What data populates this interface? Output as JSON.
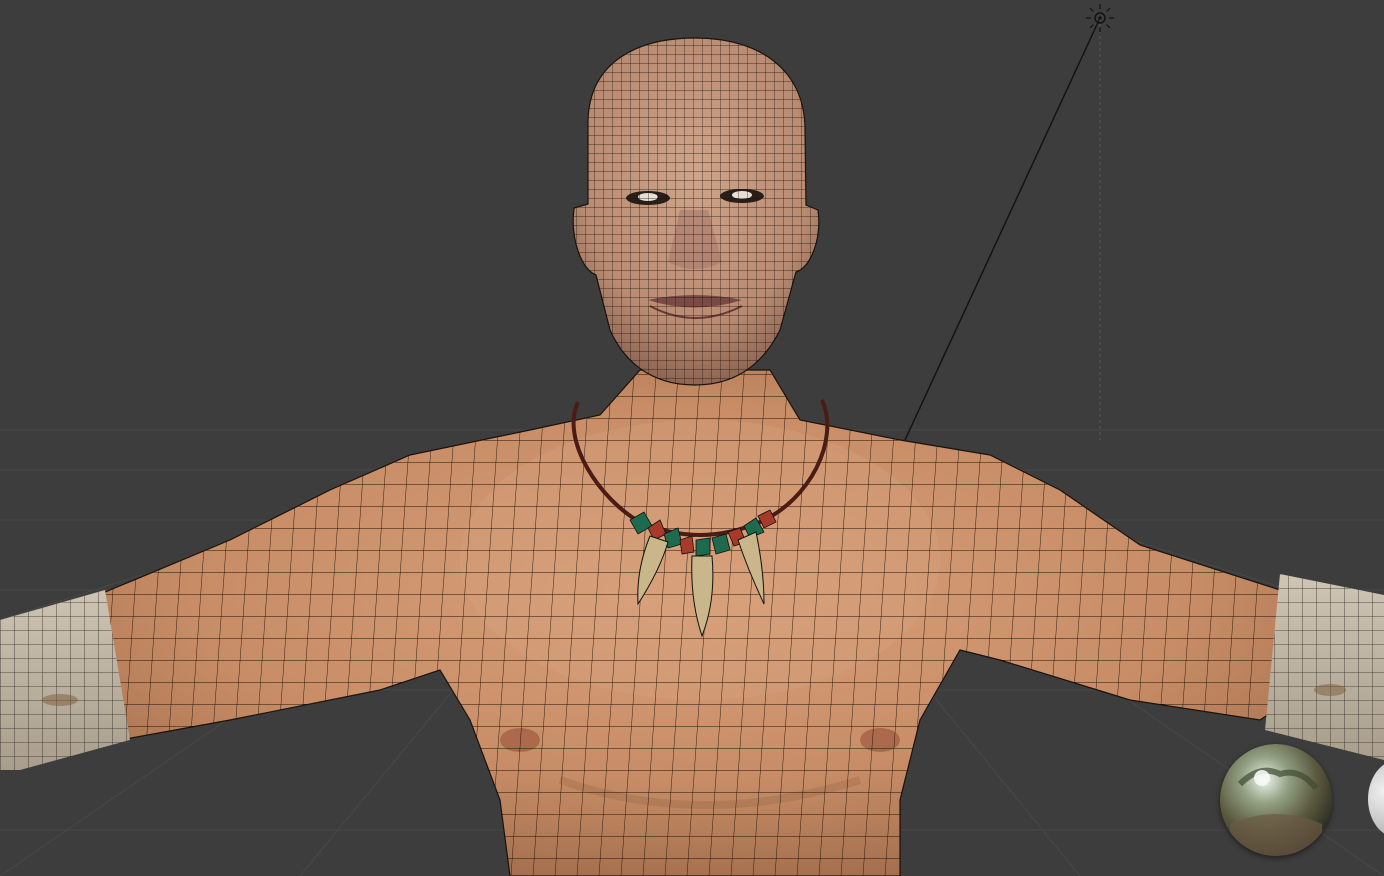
{
  "viewport": {
    "background_color": "#3d3d3d",
    "grid_color": "#474747"
  },
  "scene": {
    "objects": [
      {
        "name": "character-body",
        "shading": "textured",
        "overlay": "wireframe"
      },
      {
        "name": "necklace",
        "icon": "tooth-necklace"
      },
      {
        "name": "light-lamp",
        "icon": "sun-lamp-icon"
      }
    ],
    "colors": {
      "skin": "#c98f68",
      "skin_shadow": "#9a6646",
      "sleeve": "#b8ad9d",
      "wire": "#1a120c",
      "necklace_cord": "#4a1c14",
      "bead_green": "#1e6a4e",
      "bead_red": "#a83a2a",
      "tooth": "#c9b68a"
    }
  },
  "overlays": {
    "hdri_preview": {
      "icon": "hdri-sphere-icon",
      "label": ""
    }
  }
}
